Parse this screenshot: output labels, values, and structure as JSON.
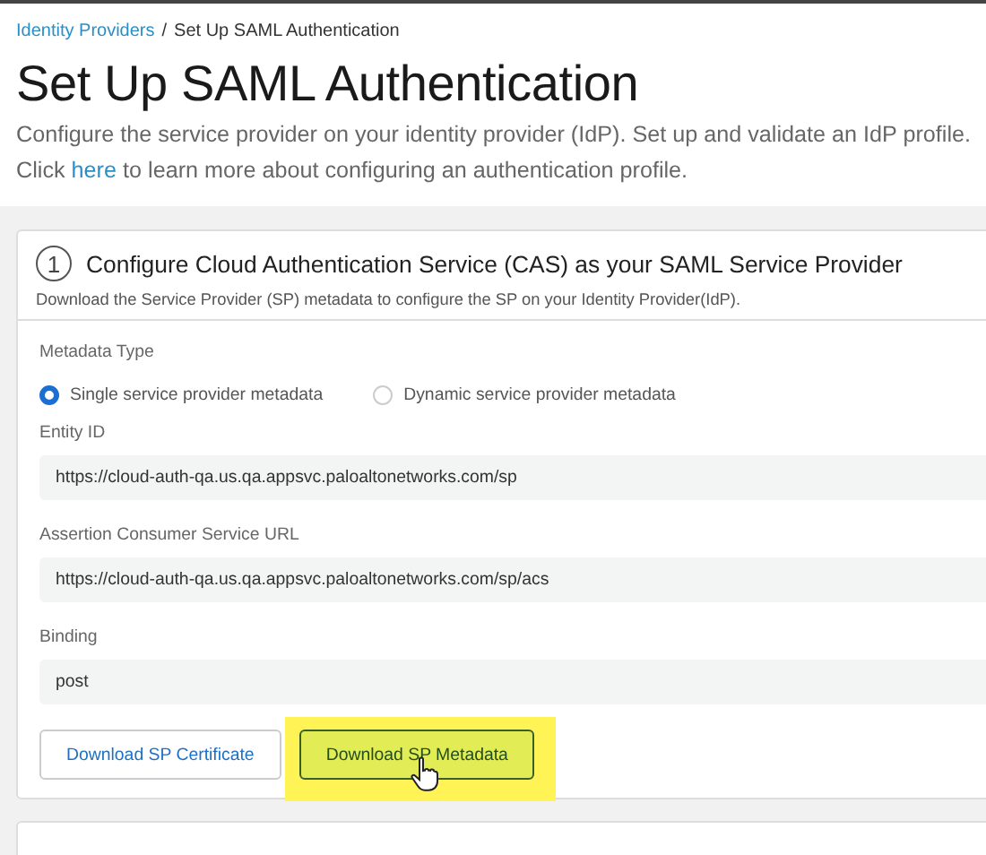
{
  "breadcrumb": [
    {
      "label": "Identity Providers",
      "kind": "link"
    },
    {
      "label": "Set Up SAML Authentication",
      "kind": "current"
    }
  ],
  "breadcrumb_separator": "/",
  "title": "Set Up SAML Authentication",
  "description": "Configure the service provider on your identity provider (IdP). Set up and validate an IdP profile.",
  "help": {
    "before": "Click ",
    "link": "here",
    "after": " to learn more about configuring an authentication profile."
  },
  "step": {
    "number": "1",
    "title": "Configure Cloud Authentication Service (CAS) as your SAML Service Provider",
    "subtitle": "Download the Service Provider (SP) metadata to configure the SP on your Identity Provider(IdP)."
  },
  "metadata_type": {
    "label": "Metadata Type",
    "options": [
      {
        "label": "Single service provider metadata",
        "selected": true
      },
      {
        "label": "Dynamic service provider metadata",
        "selected": false
      }
    ]
  },
  "fields": [
    {
      "label": "Entity ID",
      "value": "https://cloud-auth-qa.us.qa.appsvc.paloaltonetworks.com/sp"
    },
    {
      "label": "Assertion Consumer Service URL",
      "value": "https://cloud-auth-qa.us.qa.appsvc.paloaltonetworks.com/sp/acs"
    },
    {
      "label": "Binding",
      "value": "post"
    }
  ],
  "buttons": [
    {
      "label": "Download SP Certificate",
      "kind": "outline",
      "highlighted": false
    },
    {
      "label": "Download SP Metadata",
      "kind": "filled",
      "highlighted": true
    }
  ]
}
